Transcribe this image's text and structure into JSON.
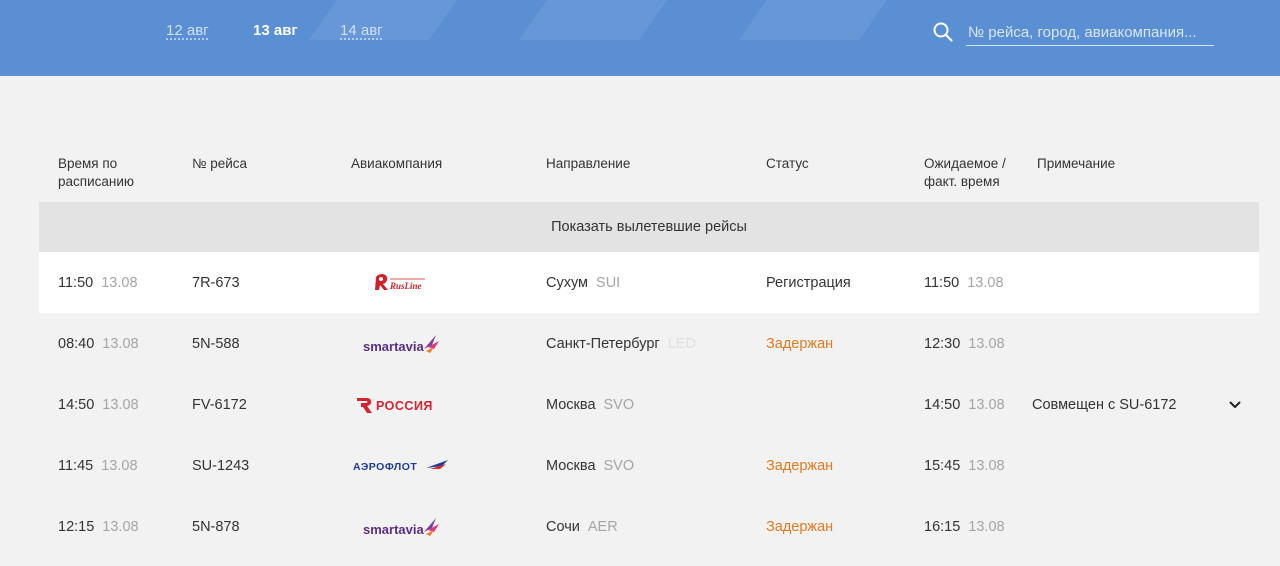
{
  "header": {
    "dates": [
      {
        "label": "12 авг",
        "active": false
      },
      {
        "label": "13 авг",
        "active": true
      },
      {
        "label": "14 авг",
        "active": false
      }
    ],
    "search": {
      "placeholder": "№ рейса, город, авиакомпания..."
    }
  },
  "table": {
    "columns": {
      "scheduled_line1": "Время по",
      "scheduled_line2": "расписанию",
      "flight": "№ рейса",
      "airline": "Авиакомпания",
      "destination": "Направление",
      "status": "Статус",
      "expected_line1": "Ожидаемое /",
      "expected_line2": "факт. время",
      "note": "Примечание"
    },
    "show_departed_label": "Показать вылетевшие рейсы",
    "rows": [
      {
        "time": "11:50",
        "date": "13.08",
        "flight": "7R-673",
        "airline": "RusLine",
        "city": "Сухум",
        "code": "SUI",
        "status": "Регистрация",
        "exp_time": "11:50",
        "exp_date": "13.08",
        "note": ""
      },
      {
        "time": "08:40",
        "date": "13.08",
        "flight": "5N-588",
        "airline": "smartavia",
        "city": "Санкт-Петербург",
        "code": "LED",
        "status": "Задержан",
        "exp_time": "12:30",
        "exp_date": "13.08",
        "note": ""
      },
      {
        "time": "14:50",
        "date": "13.08",
        "flight": "FV-6172",
        "airline": "РОССИЯ",
        "city": "Москва",
        "code": "SVO",
        "status": "",
        "exp_time": "14:50",
        "exp_date": "13.08",
        "note": "Совмещен с SU-6172"
      },
      {
        "time": "11:45",
        "date": "13.08",
        "flight": "SU-1243",
        "airline": "АЭРОФЛОТ",
        "city": "Москва",
        "code": "SVO",
        "status": "Задержан",
        "exp_time": "15:45",
        "exp_date": "13.08",
        "note": ""
      },
      {
        "time": "12:15",
        "date": "13.08",
        "flight": "5N-878",
        "airline": "smartavia",
        "city": "Сочи",
        "code": "AER",
        "status": "Задержан",
        "exp_time": "16:15",
        "exp_date": "13.08",
        "note": ""
      }
    ]
  },
  "colors": {
    "header_bg": "#5b8fd4",
    "delayed": "#e07a1f",
    "highlight_row": "#ffffff",
    "page_bg": "#f2f2f2"
  },
  "icons": {
    "search": "search-icon",
    "expand": "chevron-down-icon"
  }
}
